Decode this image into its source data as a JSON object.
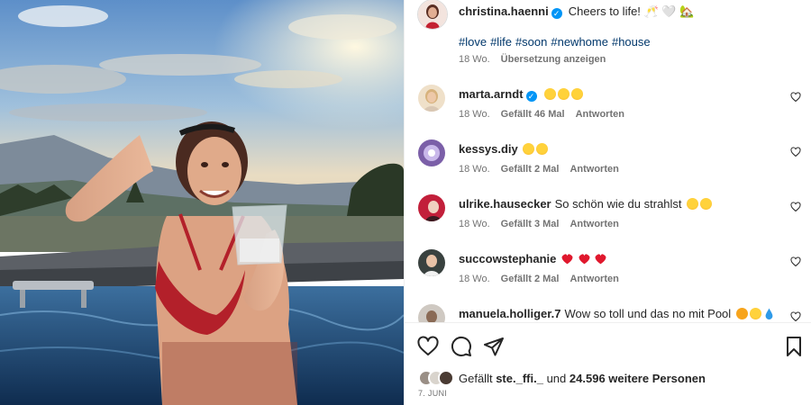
{
  "post": {
    "author": "christina.haenni",
    "caption": "Cheers to life! 🥂 🤍 🏡",
    "hashtags": [
      "#love",
      "#life",
      "#soon",
      "#newhome",
      "#house"
    ],
    "age": "18 Wo.",
    "translate_label": "Übersetzung anzeigen"
  },
  "comments": [
    {
      "user": "marta.arndt",
      "verified": true,
      "text": "",
      "emojis": [
        "grin",
        "grin",
        "grin"
      ],
      "age": "18 Wo.",
      "likes": "Gefällt 46 Mal",
      "reply": "Antworten"
    },
    {
      "user": "kessys.diy",
      "verified": false,
      "text": "",
      "emojis": [
        "grin",
        "grin"
      ],
      "age": "18 Wo.",
      "likes": "Gefällt 2 Mal",
      "reply": "Antworten"
    },
    {
      "user": "ulrike.hausecker",
      "verified": false,
      "text": "So schön wie du strahlst",
      "emojis": [
        "kiss",
        "kiss"
      ],
      "age": "18 Wo.",
      "likes": "Gefällt 3 Mal",
      "reply": "Antworten"
    },
    {
      "user": "succowstephanie",
      "verified": false,
      "text": "",
      "emojis": [
        "heart",
        "heart",
        "heart"
      ],
      "age": "18 Wo.",
      "likes": "Gefällt 2 Mal",
      "reply": "Antworten"
    },
    {
      "user": "manuela.holliger.7",
      "verified": false,
      "text": "Wow so toll und das no mit Pool",
      "emojis": [
        "sun",
        "grin",
        "drop"
      ],
      "age": "",
      "likes": "",
      "reply": ""
    }
  ],
  "liked_by": {
    "prefix": "Gefällt",
    "first_user": "ste._ffi._",
    "connector": "und",
    "others": "24.596 weitere Personen"
  },
  "date": "7. JUNI",
  "icons": [
    "heart-icon",
    "comment-icon",
    "share-icon",
    "bookmark-icon",
    "verified-icon"
  ],
  "colors": {
    "link": "#00376b",
    "verified": "#0095f6",
    "meta": "#737373",
    "text": "#262626"
  }
}
